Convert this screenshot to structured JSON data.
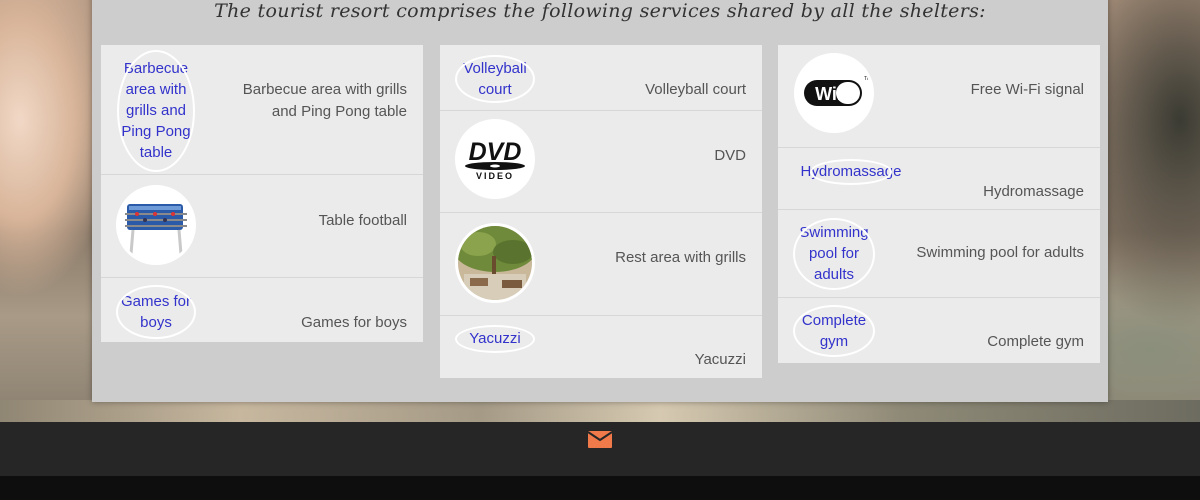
{
  "heading": "The tourist resort comprises the following services shared by all the shelters:",
  "columns": [
    {
      "items": [
        {
          "link": "Barbecue area with grills and Ping Pong table",
          "description": "Barbecue area with grills and Ping Pong table"
        },
        {
          "link": "",
          "description": "Table football",
          "icon": "table-football-icon"
        },
        {
          "link": "Games for boys",
          "description": "Games for boys"
        }
      ]
    },
    {
      "items": [
        {
          "link": "Volleyball court",
          "description": "Volleyball court"
        },
        {
          "link": "",
          "description": "DVD",
          "icon": "dvd-video-icon",
          "icon_text": "DVD",
          "icon_subtext": "VIDEO"
        },
        {
          "link": "",
          "description": "Rest area with grills",
          "icon": "rest-area-photo-icon"
        },
        {
          "link": "Yacuzzi",
          "description": "Yacuzzi"
        }
      ]
    },
    {
      "items": [
        {
          "link": "",
          "description": "Free Wi-Fi signal",
          "icon": "wifi-icon",
          "icon_text": "WiFi",
          "icon_mark": "TM"
        },
        {
          "link": "Hydromassage",
          "description": "Hydromassage"
        },
        {
          "link": "Swimming pool for adults",
          "description": "Swimming pool for adults"
        },
        {
          "link": "Complete gym",
          "description": "Complete gym"
        }
      ]
    }
  ],
  "footer": {
    "mail_icon": "envelope-icon"
  },
  "colors": {
    "accent": "#f07a4a",
    "link": "#3333cc",
    "panel": "#cdcdcd",
    "card": "#ebebeb",
    "footer": "#262626"
  }
}
